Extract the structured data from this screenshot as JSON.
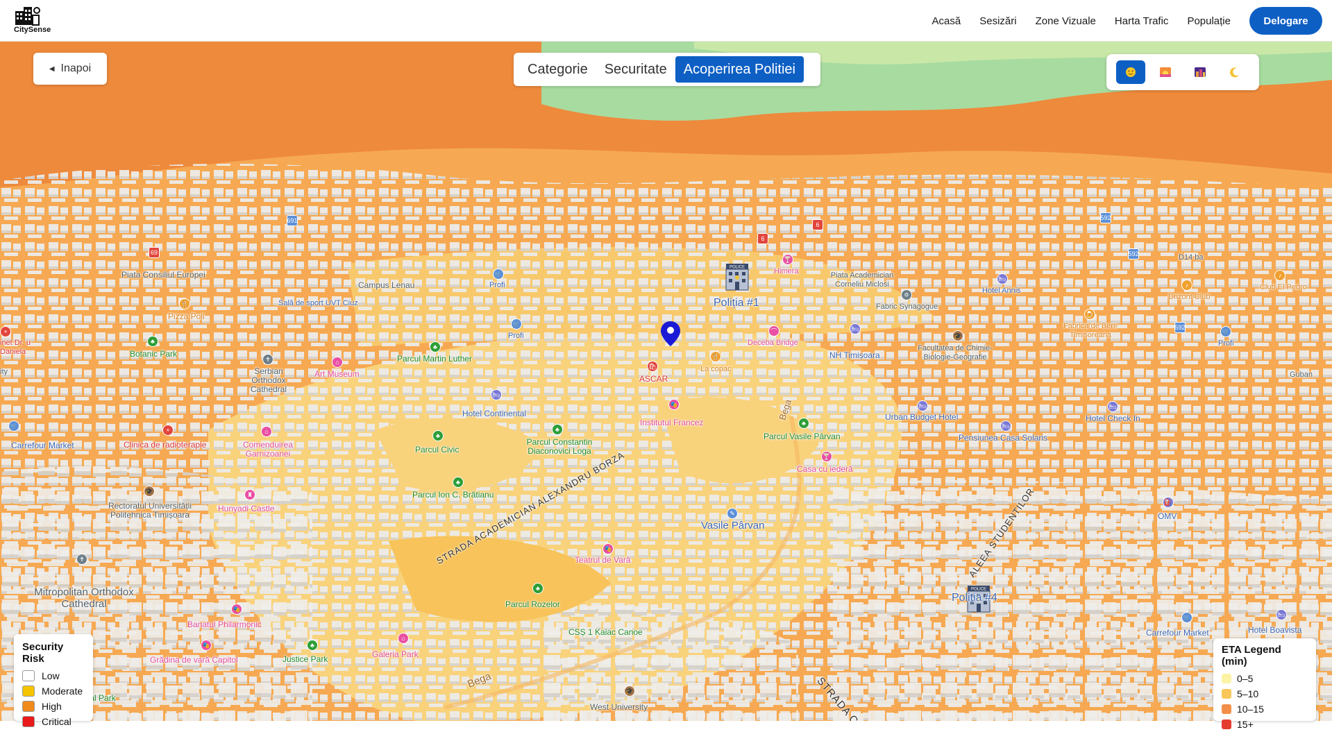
{
  "brand": {
    "name": "CitySense",
    "logo_icon": "building-icon"
  },
  "nav": {
    "links": [
      "Acasă",
      "Sesizări",
      "Zone Vizuale",
      "Harta Trafic",
      "Populație"
    ],
    "logout_label": "Delogare",
    "accent": "#0d5fc4"
  },
  "back_button": {
    "label": "Inapoi",
    "icon": "chevron-left-icon"
  },
  "tabs": {
    "items": [
      "Categorie",
      "Securitate",
      "Acoperirea Politiei"
    ],
    "active": "Acoperirea Politiei"
  },
  "theme_switcher": {
    "items": [
      "sun-icon",
      "sunrise-icon",
      "night-city-icon",
      "moon-icon"
    ],
    "active": "sun-icon"
  },
  "map": {
    "police_labels": [
      "Poliția #1",
      "Poliția #4"
    ],
    "places": {
      "piata_consiliul": "Piata Consiliul Europei",
      "campus_lenau": "Campus Lenau",
      "sala_sport": "Sală de sport UVT Ciuz",
      "pizza_poli": "Pizza Poli",
      "botanic_park": "Botanic Park",
      "serbian_cathedral": "Serbian Orthodox Cathedral",
      "art_museum": "Art Museum",
      "parcul_martin_luther": "Parcul Martin Luther",
      "profi_1": "Profi",
      "profi_2": "Profi",
      "profi_3": "Profi",
      "himera": "Himera",
      "piata_academician": "Piata Academician Corneliu Miclosi",
      "hotel_annis": "Hotel Annis",
      "d14_ba": "D14 ba",
      "drizzt_club": "Drizont Club",
      "club_el_pedro": "Club El Pedro",
      "fabric_synagogue": "Fabric Synagogue",
      "deceba_bridge": "Deceba Bridge",
      "nh_timisoara": "NH Timișoara",
      "facultatea_chimie": "Facultatea de Chimie-Biologie-Geografie",
      "fabrica_bere": "Fabrica de Bere Timisoreana",
      "la_copac": "La copac",
      "ascar": "ASCAR",
      "hotel_continental": "Hotel Continental",
      "institutul_francez": "Institutul Francez",
      "carrefour_1": "Carrefour Market",
      "clinica": "Clinica de radioterapie",
      "comenduirea": "Comenduirea Garnizoanei",
      "parcul_civic": "Parcul Civic",
      "parcul_constantin": "Parcul Constantin Diaconovici Loga",
      "parcul_vasile": "Parcul Vasile Pârvan",
      "urban_budget": "Urban Budget Hotel",
      "hotel_check_in": "Hotel Check In",
      "pensiunea": "Pensiunea Casa Solaris",
      "gubani": "Guban",
      "casa_iedera": "Casa cu iederă",
      "parcul_ion": "Parcul Ion C. Brătianu",
      "rectoratul": "Rectoratul Universității Politehnica Timișoara",
      "hunyadi": "Hunyadi Castle",
      "vasile_parvan": "Vasile Pârvan",
      "omv": "OMV",
      "mitropolitan": "Mitropolitan Orthodox Cathedral",
      "teatrul_vara": "Teatrul de Vară",
      "parcul_rozelor": "Parcul Rozelor",
      "banatul": "Banatul Philarmonic",
      "css_kaiac": "CSȘ 1 Kaiac Canoe",
      "gradina_vara": "Grădina de vară Capitol",
      "justice_park": "Justice Park",
      "galeria_park": "Galeria Park",
      "central_park": "Central Park",
      "west_university": "West University",
      "carrefour_2": "Carrefour Market",
      "hotel_boavista": "Hotel Boavista",
      "bega_1": "Bega",
      "bega_2": "Bega",
      "inet": "inet Dr. u Daniela",
      "ity": "ity"
    },
    "streets": [
      "STRADA ACADEMICIAN ALEXANDRU BORZA",
      "ALEEA STUDENTILOR",
      "STRADA CLUJ"
    ],
    "road_badges": [
      "691",
      "69",
      "6",
      "6",
      "592",
      "592",
      "592"
    ]
  },
  "security_legend": {
    "title": "Security Risk",
    "items": [
      {
        "label": "Low",
        "color": "#ffffff"
      },
      {
        "label": "Moderate",
        "color": "#f5c400"
      },
      {
        "label": "High",
        "color": "#f08a1c"
      },
      {
        "label": "Critical",
        "color": "#e81a1a"
      }
    ]
  },
  "eta_legend": {
    "title": "ETA Legend (min)",
    "items": [
      {
        "label": "0–5",
        "color": "#fdf3a6"
      },
      {
        "label": "5–10",
        "color": "#f8c659"
      },
      {
        "label": "10–15",
        "color": "#f2904a"
      },
      {
        "label": "15+",
        "color": "#e53a2e"
      }
    ]
  }
}
